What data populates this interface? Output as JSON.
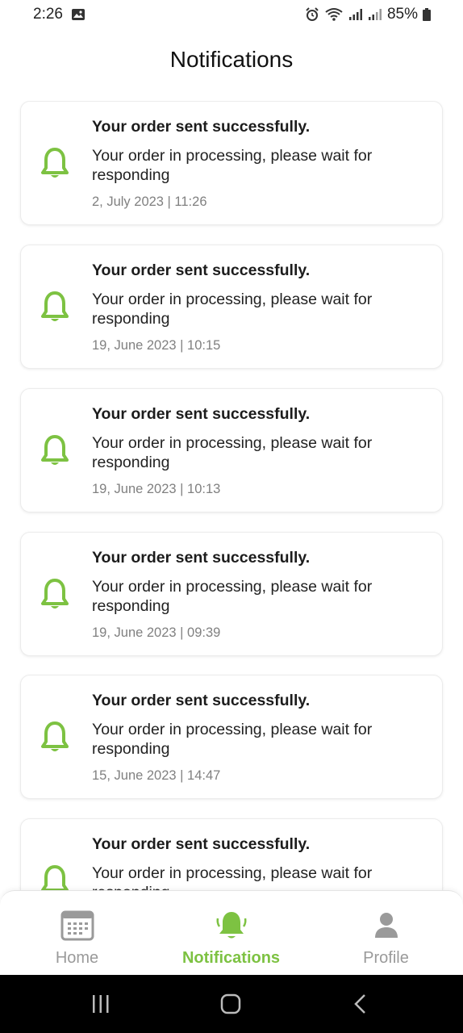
{
  "status_bar": {
    "time": "2:26",
    "battery": "85%"
  },
  "page": {
    "title": "Notifications"
  },
  "notifications": [
    {
      "title": "Your order sent successfully.",
      "body": "Your order in processing, please wait for responding",
      "time": "2, July 2023 | 11:26"
    },
    {
      "title": "Your order sent successfully.",
      "body": "Your order in processing, please wait for responding",
      "time": "19, June 2023 | 10:15"
    },
    {
      "title": "Your order sent successfully.",
      "body": "Your order in processing, please wait for responding",
      "time": "19, June 2023 | 10:13"
    },
    {
      "title": "Your order sent successfully.",
      "body": "Your order in processing, please wait for responding",
      "time": "19, June 2023 | 09:39"
    },
    {
      "title": "Your order sent successfully.",
      "body": "Your order in processing, please wait for responding",
      "time": "15, June 2023 | 14:47"
    },
    {
      "title": "Your order sent successfully.",
      "body": "Your order in processing, please wait for responding",
      "time": ""
    }
  ],
  "bottom_nav": {
    "items": [
      {
        "label": "Home",
        "icon": "calendar-icon",
        "active": false
      },
      {
        "label": "Notifications",
        "icon": "bell-icon",
        "active": true
      },
      {
        "label": "Profile",
        "icon": "person-icon",
        "active": false
      }
    ]
  },
  "colors": {
    "accent": "#7dc242",
    "inactive": "#9a9a9a"
  }
}
